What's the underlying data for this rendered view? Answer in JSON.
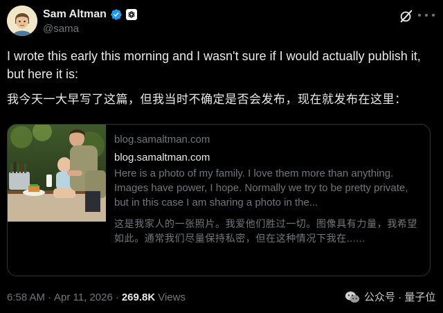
{
  "author": {
    "display_name": "Sam Altman",
    "handle": "@sama",
    "avatar_icon": "cartoon-avatar-icon",
    "verified_icon": "verified-badge-icon",
    "affiliation_icon": "openai-logo-icon"
  },
  "header_actions": {
    "grok_icon": "grok-icon",
    "more_icon": "more-options-icon"
  },
  "tweet": {
    "text": "I wrote this early this morning and I wasn't sure if I would actually publish it, but here it is:",
    "translation": "我今天一大早写了这篇，但我当时不确定是否会发布，现在就发布在这里："
  },
  "link_card": {
    "domain": "blog.samaltman.com",
    "title": "blog.samaltman.com",
    "description": "Here is a photo of my family. I love them more than anything. Images have power, I hope. Normally we try to be pretty private, but in this case I am sharing a photo in the...",
    "description_translation": "这是我家人的一张照片。我爱他们胜过一切。图像具有力量，我希望如此。通常我们尽量保持私密，但在这种情况下我在......"
  },
  "meta": {
    "time": "6:58 AM",
    "separator": "·",
    "date": "Apr 11, 2026",
    "views_count": "269.8K",
    "views_label": "Views"
  },
  "watermark": {
    "icon": "wechat-icon",
    "text": "公众号 · 量子位"
  },
  "colors": {
    "background": "#000000",
    "text_primary": "#e7e9ea",
    "text_secondary": "#71767b",
    "verified_blue": "#1d9bf0",
    "border": "#2f3336"
  }
}
